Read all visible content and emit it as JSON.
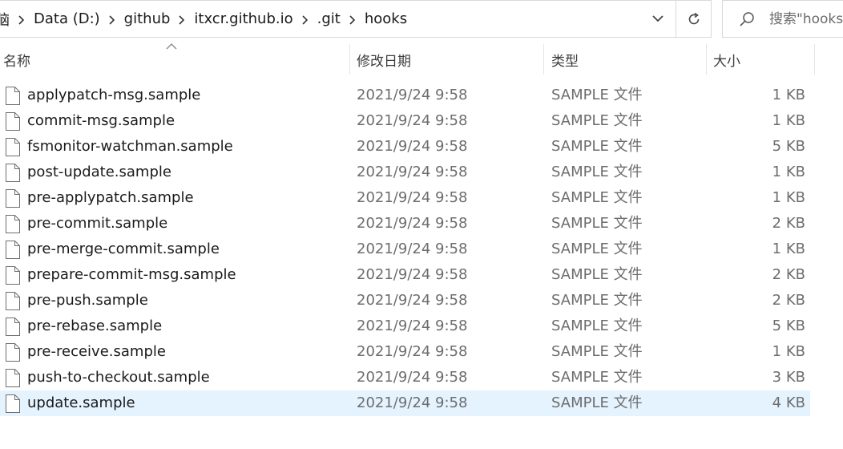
{
  "address_bar": {
    "crumbs": [
      "Data (D:)",
      "github",
      "itxcr.github.io",
      ".git",
      "hooks"
    ],
    "leading_cut_char": "脑"
  },
  "search": {
    "placeholder": "搜索\"hooks\""
  },
  "icons": {
    "chevron": "chevron-right-icon",
    "dropdown": "chevron-down-icon",
    "refresh": "refresh-icon",
    "search": "search-icon",
    "file": "file-icon",
    "sort": "sort-up-icon"
  },
  "columns": {
    "name": "名称",
    "date": "修改日期",
    "type": "类型",
    "size": "大小"
  },
  "colors": {
    "selected_row": "#e5f3ff",
    "secondary_text": "#6d6d6d"
  },
  "files": [
    {
      "name": "applypatch-msg.sample",
      "date": "2021/9/24 9:58",
      "type": "SAMPLE 文件",
      "size": "1 KB"
    },
    {
      "name": "commit-msg.sample",
      "date": "2021/9/24 9:58",
      "type": "SAMPLE 文件",
      "size": "1 KB"
    },
    {
      "name": "fsmonitor-watchman.sample",
      "date": "2021/9/24 9:58",
      "type": "SAMPLE 文件",
      "size": "5 KB"
    },
    {
      "name": "post-update.sample",
      "date": "2021/9/24 9:58",
      "type": "SAMPLE 文件",
      "size": "1 KB"
    },
    {
      "name": "pre-applypatch.sample",
      "date": "2021/9/24 9:58",
      "type": "SAMPLE 文件",
      "size": "1 KB"
    },
    {
      "name": "pre-commit.sample",
      "date": "2021/9/24 9:58",
      "type": "SAMPLE 文件",
      "size": "2 KB"
    },
    {
      "name": "pre-merge-commit.sample",
      "date": "2021/9/24 9:58",
      "type": "SAMPLE 文件",
      "size": "1 KB"
    },
    {
      "name": "prepare-commit-msg.sample",
      "date": "2021/9/24 9:58",
      "type": "SAMPLE 文件",
      "size": "2 KB"
    },
    {
      "name": "pre-push.sample",
      "date": "2021/9/24 9:58",
      "type": "SAMPLE 文件",
      "size": "2 KB"
    },
    {
      "name": "pre-rebase.sample",
      "date": "2021/9/24 9:58",
      "type": "SAMPLE 文件",
      "size": "5 KB"
    },
    {
      "name": "pre-receive.sample",
      "date": "2021/9/24 9:58",
      "type": "SAMPLE 文件",
      "size": "1 KB"
    },
    {
      "name": "push-to-checkout.sample",
      "date": "2021/9/24 9:58",
      "type": "SAMPLE 文件",
      "size": "3 KB"
    },
    {
      "name": "update.sample",
      "date": "2021/9/24 9:58",
      "type": "SAMPLE 文件",
      "size": "4 KB",
      "selected": true
    }
  ]
}
